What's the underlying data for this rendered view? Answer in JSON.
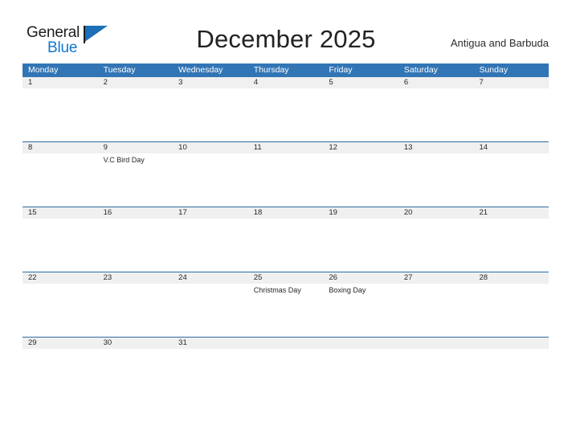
{
  "brand": {
    "name_part1": "General",
    "name_part2": "Blue",
    "flag_icon": "flag-triangle-icon",
    "accent_color": "#1277cf"
  },
  "header": {
    "title": "December 2025",
    "country": "Antigua and Barbuda"
  },
  "colors": {
    "header_blue": "#3275b5",
    "rule_blue": "#2e6da4",
    "date_band_gray": "#f0f0f0",
    "text_dark": "#262626"
  },
  "calendar": {
    "month": "December",
    "year": "2025",
    "weekday_headers": [
      "Monday",
      "Tuesday",
      "Wednesday",
      "Thursday",
      "Friday",
      "Saturday",
      "Sunday"
    ],
    "weeks": [
      {
        "dates": [
          "1",
          "2",
          "3",
          "4",
          "5",
          "6",
          "7"
        ],
        "events": [
          "",
          "",
          "",
          "",
          "",
          "",
          ""
        ]
      },
      {
        "dates": [
          "8",
          "9",
          "10",
          "11",
          "12",
          "13",
          "14"
        ],
        "events": [
          "",
          "V.C Bird Day",
          "",
          "",
          "",
          "",
          ""
        ]
      },
      {
        "dates": [
          "15",
          "16",
          "17",
          "18",
          "19",
          "20",
          "21"
        ],
        "events": [
          "",
          "",
          "",
          "",
          "",
          "",
          ""
        ]
      },
      {
        "dates": [
          "22",
          "23",
          "24",
          "25",
          "26",
          "27",
          "28"
        ],
        "events": [
          "",
          "",
          "",
          "Christmas Day",
          "Boxing Day",
          "",
          ""
        ]
      },
      {
        "dates": [
          "29",
          "30",
          "31",
          "",
          "",
          "",
          ""
        ],
        "events": [
          "",
          "",
          "",
          "",
          "",
          "",
          ""
        ]
      }
    ]
  }
}
